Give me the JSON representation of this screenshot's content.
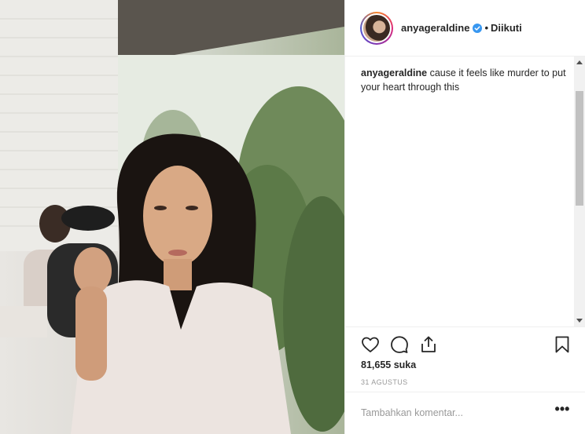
{
  "post": {
    "author": "anyageraldine",
    "follow_status": "Diikuti",
    "separator": "•",
    "caption_user": "anyageraldine",
    "caption_text": "cause it feels like murder to put your heart through this",
    "likes": "81,655 suka",
    "date": "31 AGUSTUS"
  },
  "comment": {
    "placeholder": "Tambahkan komentar...",
    "more": "•••"
  },
  "colors": {
    "verified_badge": "#3897f0",
    "text": "#262626",
    "muted": "#999999",
    "border": "#efefef"
  },
  "icons": {
    "like": "heart-icon",
    "comment": "comment-icon",
    "share": "share-icon",
    "save": "bookmark-icon",
    "verified": "verified-badge-icon"
  }
}
